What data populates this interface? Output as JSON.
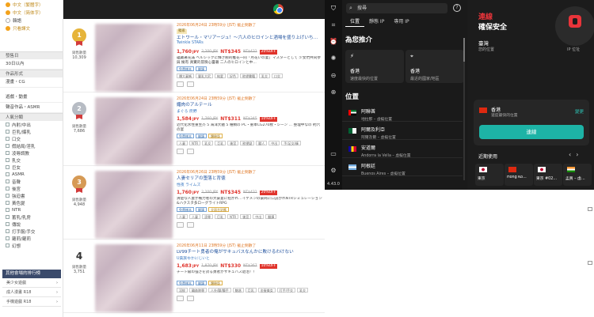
{
  "sidebar": {
    "checks": [
      {
        "label": "中文（繁體字）",
        "checked": true
      },
      {
        "label": "中文（简体字）",
        "checked": true
      },
      {
        "label": "韓語",
        "checked": false
      },
      {
        "label": "只看譯文",
        "checked": true
      }
    ],
    "sections": {
      "release": "發售日",
      "within30": "30日以內",
      "format": "作品形式",
      "format_item": "漫畫・CG",
      "other1": "遊戲・動畫",
      "other2": "聲音作品・ASMR",
      "popular": "人氣分類"
    },
    "genre_opts": [
      "內射/中出",
      "巨乳/爆乳",
      "口交",
      "假結局/淫乳",
      "凌辱調教",
      "乳交",
      "巨女",
      "ASMR",
      "音聲",
      "後宮",
      "強迫書",
      "黃色變",
      "NTR",
      "蓄乳/乳房",
      "傳說",
      "打手服/手交",
      "蘿莉/蘿莉",
      "幻想"
    ],
    "ranking_title": "其他會場的排行榜",
    "rankings": [
      "美少女遊戲",
      "成人漫畫 R18",
      "手機遊戲 R18"
    ]
  },
  "items": [
    {
      "rank": "1",
      "medal": "gold",
      "sold_label": "銷售數量",
      "sold": "10,309",
      "date": "2026年06月24日 23時59分 (JST) 截止倒數了",
      "tag": "獨家",
      "title": "エトワール・マリアージュ！～六人のヒロインと酒場を盛り上げいち…",
      "circle": "Twinkle STARs",
      "price": "1,760",
      "price_unit": "JPY",
      "old": "2,200 JPY",
      "nt": "NT$345",
      "nt_old": "NT$431",
      "off": "20%OFF",
      "desc": "蘊藏著充滿 ベルシックに輝き腕的推花一同「月花いの宴」マスターとして \n 少女們共同參與 擁有 真實的冒險心靈著 二人のヒロインと中…",
      "badges": [
        "免費樣本",
        "翻譯"
      ],
      "genres": [
        "爆大妻媽",
        "豐乳大尻",
        "純愛",
        "好色",
        "慾望書籍",
        "乳交",
        "口交"
      ]
    },
    {
      "rank": "2",
      "medal": "silver",
      "sold_label": "銷售數量",
      "sold": "7,686",
      "date": "2026年06月24日 23時59分 (JST) 截止倒數了",
      "tag": "",
      "title": "媚肉のアルテール",
      "circle": "まぐろ 庶野",
      "price": "1,584",
      "price_unit": "JPY",
      "old": "1,760 JPY",
      "nt": "NT$311",
      "nt_old": "NT$345",
      "off": "10%OFF",
      "desc": "近代化水性重生芥 5 海洋大體 5 種類の PC・重本CG270枚・シーン … \n 整理中なの 約六の宴",
      "badges": [
        "免費樣本",
        "翻譯",
        "體驗版"
      ],
      "genres": [
        "人妻",
        "NTR",
        "乳交",
        "巨乳",
        "後宮",
        "慾望變",
        "獸人",
        "中出",
        "手/足交/褲"
      ]
    },
    {
      "rank": "3",
      "medal": "bronze",
      "sold_label": "銷售數量",
      "sold": "4,948",
      "date": "2026年06月26日 23時59分 (JST) 截止倒數了",
      "tag": "",
      "title": "人妻セリアの堕落と背徳",
      "circle": "性夜 ライムズ",
      "price": "1,760",
      "price_unit": "JPY",
      "old": "2,200 JPY",
      "nt": "NT$345",
      "nt_old": "NT$431",
      "off": "20%OFF",
      "desc": "清楚な人妻が権力者の大豪宴に招かれ…イケメンの豪商に口説かれNTRシミュレーション&ハクスタ多ローグライトRPG",
      "badges": [
        "免費樣本",
        "翻譯",
        "全語言對應"
      ],
      "genres": [
        "人妻",
        "人妻",
        "凌辱",
        "巨乳",
        "NTR",
        "後宮",
        "中出",
        "翻譯"
      ]
    },
    {
      "rank": "4",
      "medal": "",
      "sold_label": "銷售數量",
      "sold": "3,751",
      "date": "2026年06月11日 23時59分 (JST) 截止倒數了",
      "tag": "",
      "title": "LV99チート勇者の俺がサキュバスなんかに敗けるわけない",
      "circle": "U貴族ゆかにじいと",
      "price": "1,683",
      "price_unit": "JPY",
      "old": "1,870 JPY",
      "nt": "NT$330",
      "nt_old": "NT$367",
      "off": "10%OFF",
      "desc": "チート級の強さを誇る勇者がサキュバス退治！！",
      "badges": [
        "免費樣本",
        "翻譯",
        "體驗版"
      ],
      "genres": [
        "淫紋",
        "輪姦陵辱",
        "人外/獸/觸手",
        "魅惑",
        "巨乳",
        "金髮美女",
        "打手/手交",
        "乳交"
      ]
    }
  ],
  "vpn": {
    "search_placeholder": "搜尋",
    "tabs": [
      "位置",
      "靜態 IP",
      "專用 IP"
    ],
    "rec_title": "為您推介",
    "rec": [
      {
        "icon": "bolt-icon",
        "title": "香港",
        "sub": "速度最快的位置"
      },
      {
        "icon": "map-pin-icon",
        "title": "香港",
        "sub": "最近的國家/地區"
      }
    ],
    "loc_title": "位置",
    "locations": [
      {
        "name": "阿聯酋",
        "sub": "地拉那 – 虛擬位置",
        "flag": "f-ae"
      },
      {
        "name": "阿爾及利亞",
        "sub": "阿爾及爾 – 虛擬位置",
        "flag": "f-dz"
      },
      {
        "name": "安道爾",
        "sub": "Andorra la Vella – 虛擬位置",
        "flag": "f-ad"
      },
      {
        "name": "阿根廷",
        "sub": "Buenos Aires – 虛擬位置",
        "flag": "f-ar"
      }
    ],
    "version": "4.43.0",
    "status_1": "連線",
    "status_2": "確保安全",
    "place": "臺灣",
    "place_sub": "您的位置",
    "ip_label": "IP 位址",
    "current": {
      "title": "香港",
      "sub": "速度最快的位置",
      "change": "變更"
    },
    "connect": "連線",
    "recent_title": "近期使用",
    "recent": [
      {
        "name": "東京",
        "flag": "f-jp"
      },
      {
        "name": "Hong Ko…",
        "flag": "f-hk"
      },
      {
        "name": "東京 #02…",
        "flag": "f-jp"
      },
      {
        "name": "孟買 – 虛…",
        "flag": "f-in"
      }
    ],
    "colors": {
      "accent": "#1db3a6",
      "brand": "#e8343a"
    }
  }
}
